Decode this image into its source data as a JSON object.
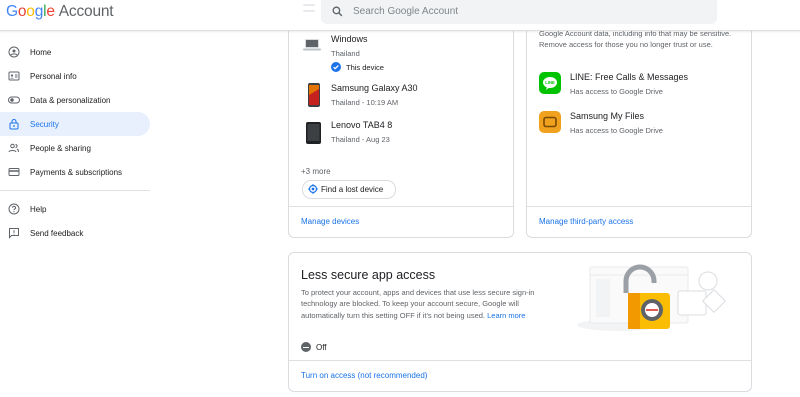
{
  "header": {
    "logo_google": "Google",
    "logo_account": "Account",
    "search_placeholder": "Search Google Account"
  },
  "sidebar": {
    "items": [
      {
        "label": "Home",
        "icon": "home-icon"
      },
      {
        "label": "Personal info",
        "icon": "id-card-icon"
      },
      {
        "label": "Data & personalization",
        "icon": "toggle-icon"
      },
      {
        "label": "Security",
        "icon": "lock-icon",
        "selected": true
      },
      {
        "label": "People & sharing",
        "icon": "people-icon"
      },
      {
        "label": "Payments & subscriptions",
        "icon": "credit-card-icon"
      }
    ],
    "secondary": [
      {
        "label": "Help",
        "icon": "help-icon"
      },
      {
        "label": "Send feedback",
        "icon": "feedback-icon"
      }
    ]
  },
  "devices": {
    "list": [
      {
        "name": "Windows",
        "location": "Thailand",
        "status": "This device"
      },
      {
        "name": "Samsung Galaxy A30",
        "detail": "Thailand - 10:19 AM"
      },
      {
        "name": "Lenovo TAB4 8",
        "detail": "Thailand - Aug 23"
      }
    ],
    "more": "+3 more",
    "find_button": "Find a lost device",
    "manage_link": "Manage devices"
  },
  "third_party": {
    "description": "Google Account data, including info that may be sensitive. Remove access for those you no longer trust or use.",
    "apps": [
      {
        "name": "LINE: Free Calls & Messages",
        "access": "Has access to Google Drive",
        "icon_color": "#00c300",
        "icon": "line-app-icon"
      },
      {
        "name": "Samsung My Files",
        "access": "Has access to Google Drive",
        "icon_color": "#f0a21e",
        "icon": "folder-app-icon"
      }
    ],
    "manage_link": "Manage third-party access"
  },
  "less_secure": {
    "title": "Less secure app access",
    "description": "To protect your account, apps and devices that use less secure sign-in technology are blocked. To keep your account secure, Google will automatically turn this setting OFF if it's not being used.",
    "learn_more": "Learn more",
    "status": "Off",
    "action_link": "Turn on access (not recommended)"
  },
  "colors": {
    "accent": "#1a73e8",
    "selected_bg": "#e8f0fe",
    "border": "#dadce0"
  }
}
